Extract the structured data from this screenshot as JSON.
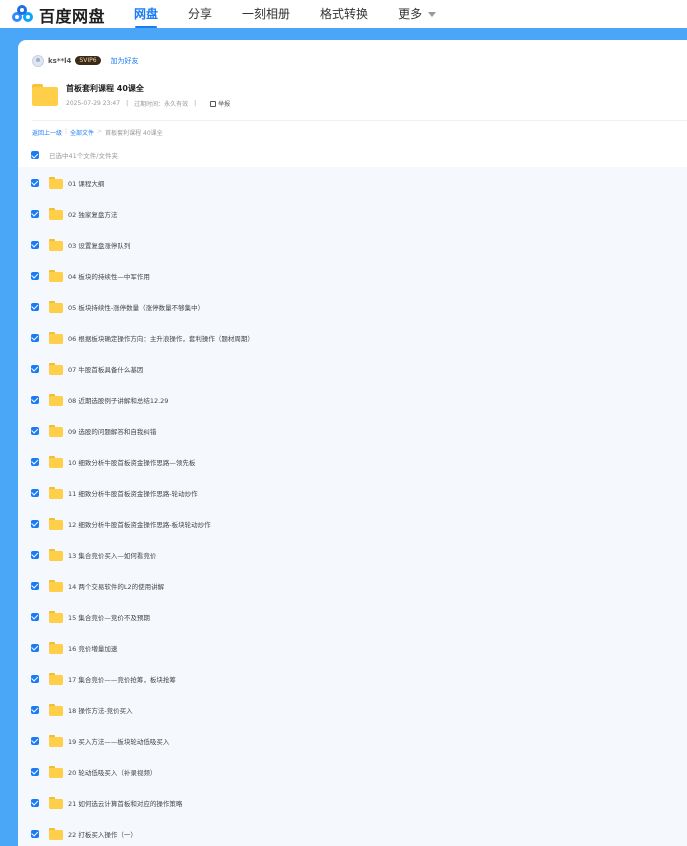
{
  "header": {
    "logo_text": "百度网盘",
    "nav": [
      {
        "label": "网盘",
        "active": true
      },
      {
        "label": "分享",
        "active": false
      },
      {
        "label": "一刻相册",
        "active": false
      },
      {
        "label": "格式转换",
        "active": false
      },
      {
        "label": "更多",
        "active": false
      }
    ]
  },
  "share": {
    "user": "ks**l4",
    "vip_badge": "SVIP6",
    "add_friend": "加为好友",
    "title": "首板套利课程 40课全",
    "date": "2025-07-29 23:47",
    "expire": "过期时间：永久有效",
    "report": "举报"
  },
  "breadcrumb": {
    "back": "返回上一级",
    "all": "全部文件",
    "current": "首板套利课程 40课全"
  },
  "selection": {
    "info": "已选中41个文件/文件夹"
  },
  "files": [
    {
      "name": "01 课程大纲"
    },
    {
      "name": "02 独家复盘方法"
    },
    {
      "name": "03 设置复盘涨停队列"
    },
    {
      "name": "04 板块的持续性—中军作用"
    },
    {
      "name": "05 板块持续性-涨停数量（涨停数量不够集中）"
    },
    {
      "name": "06 根据板块确定操作方向：主升浪操作，套利操作（题材周期）"
    },
    {
      "name": "07 牛股首板具备什么基因"
    },
    {
      "name": "08 近期选股例子讲解和总结12.29"
    },
    {
      "name": "09 选股的问题解答和自我纠错"
    },
    {
      "name": "10 细致分析牛股首板资金操作思路—领先板"
    },
    {
      "name": "11 细致分析牛股首板资金操作思路-轮动炒作"
    },
    {
      "name": "12 细致分析牛股首板资金操作思路-板块轮动炒作"
    },
    {
      "name": "13 集合竞价买入—如何看竞价"
    },
    {
      "name": "14 两个交易软件的L2的使用讲解"
    },
    {
      "name": "15 集合竞价—竞价不及预期"
    },
    {
      "name": "16 竞价増量加速"
    },
    {
      "name": "17 集合竞价——竞价抢筹，板块抢筹"
    },
    {
      "name": "18 操作方法-竞价买入"
    },
    {
      "name": "19 买入方法——板块轮动低吸买入"
    },
    {
      "name": "20 轮动低吸买入（补录视频）"
    },
    {
      "name": "21 如何选云计算首板和对应的操作策略"
    },
    {
      "name": "22 打板买入操作（一）"
    }
  ],
  "colors": {
    "accent": "#1a7cf5",
    "band": "#4aa6f6",
    "folder": "#ffcf4a",
    "list_bg": "#f5f9fe"
  }
}
